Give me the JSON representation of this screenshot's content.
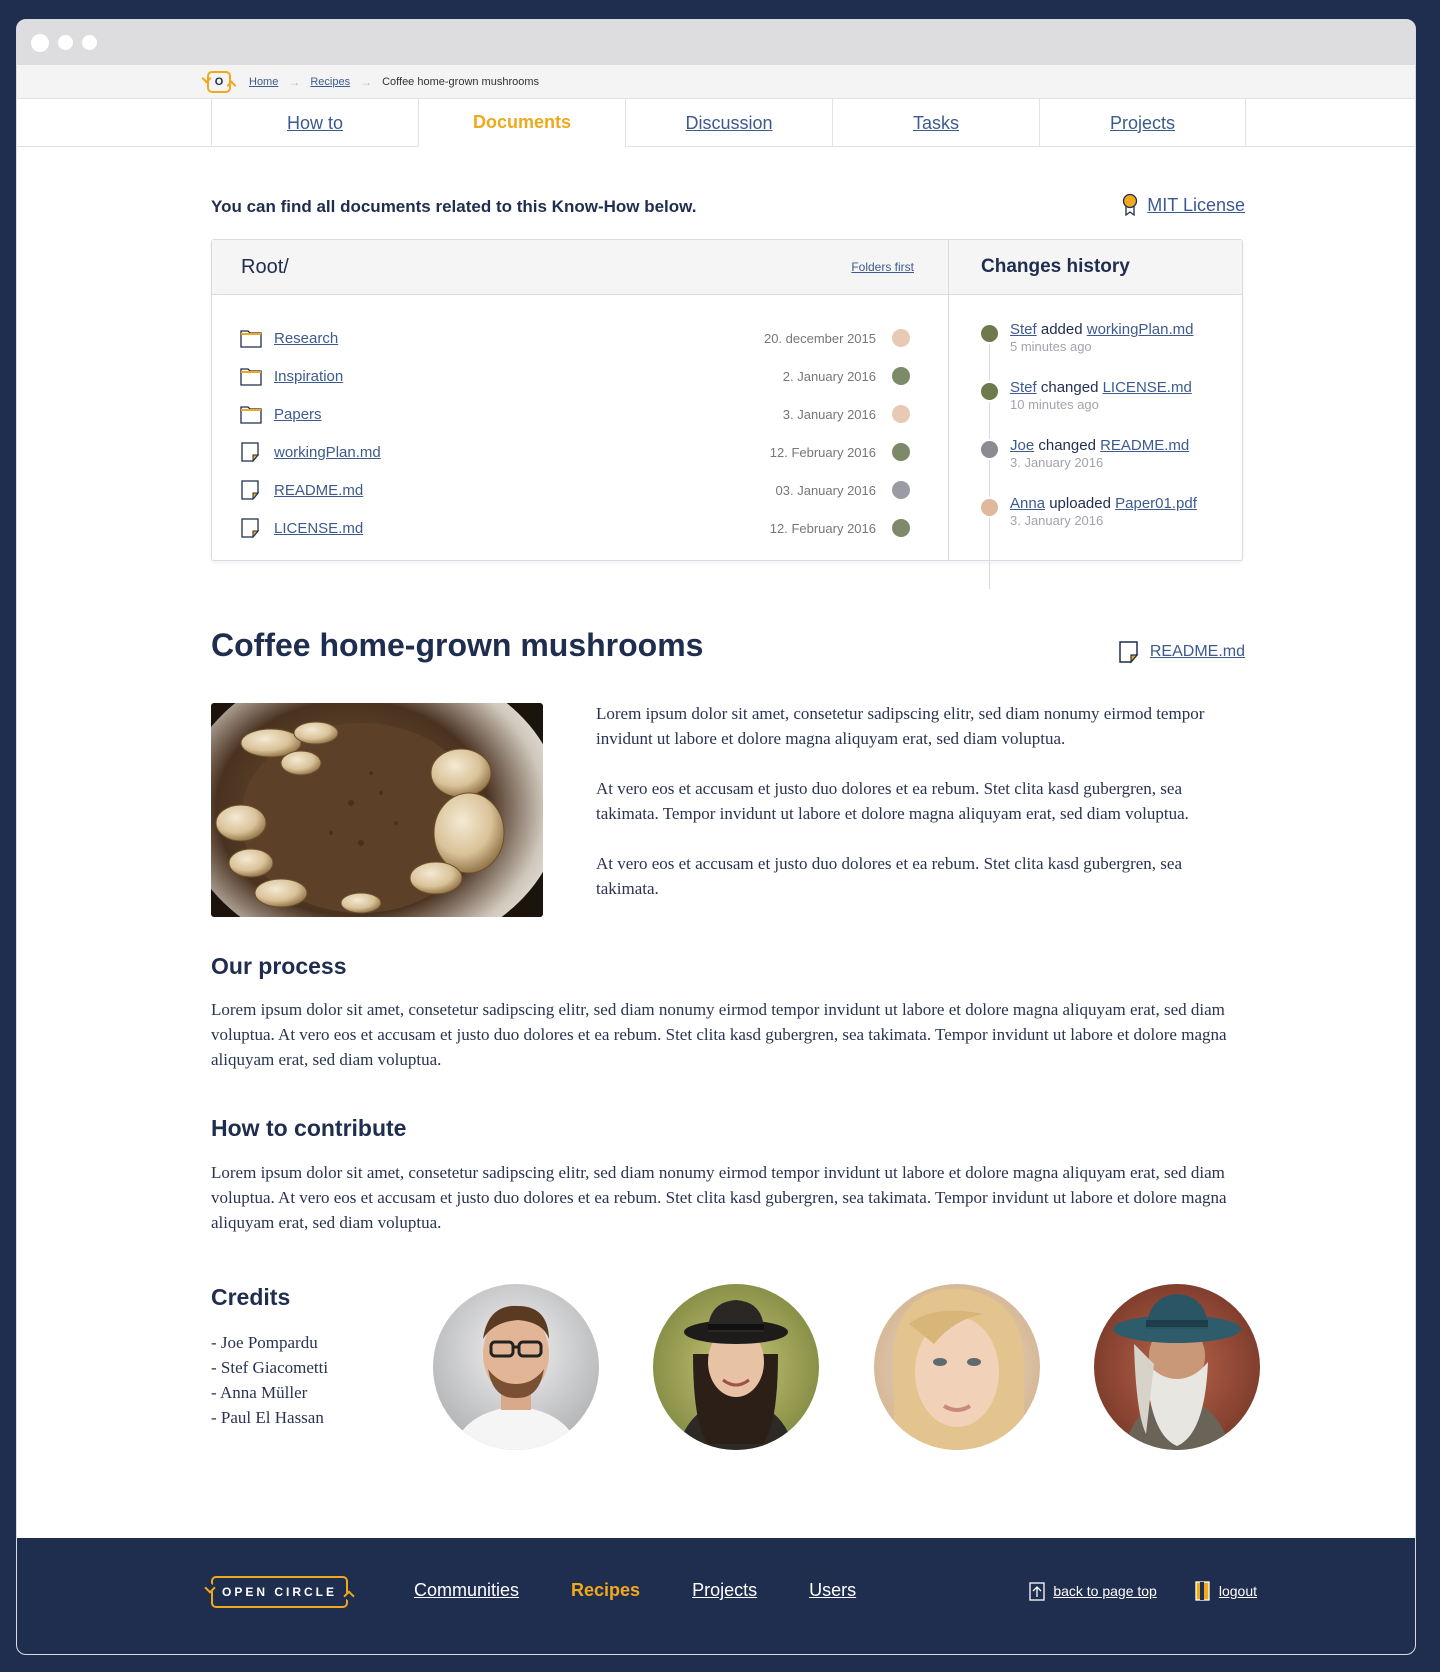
{
  "breadcrumb": {
    "logo": "O",
    "items": [
      "Home",
      "Recipes"
    ],
    "current": "Coffee home-grown mushrooms"
  },
  "tabs": [
    {
      "label": "How to",
      "active": false
    },
    {
      "label": "Documents",
      "active": true
    },
    {
      "label": "Discussion",
      "active": false
    },
    {
      "label": "Tasks",
      "active": false
    },
    {
      "label": "Projects",
      "active": false
    }
  ],
  "intro": {
    "text": "You can find all documents related to this Know-How below.",
    "license": "MIT License",
    "license_icon": "award-icon"
  },
  "files": {
    "root": "Root/",
    "sort_label": "Folders first",
    "rows": [
      {
        "name": "Research",
        "type": "folder",
        "date": "20. december 2015",
        "avatar_color": "#e8c9b4"
      },
      {
        "name": "Inspiration",
        "type": "folder",
        "date": "2. January 2016",
        "avatar_color": "#7d8a6a"
      },
      {
        "name": "Papers",
        "type": "folder",
        "date": "3. January 2016",
        "avatar_color": "#e8c9b4"
      },
      {
        "name": "workingPlan.md",
        "type": "file",
        "date": "12. February 2016",
        "avatar_color": "#7d8a6a"
      },
      {
        "name": "README.md",
        "type": "file",
        "date": "03. January 2016",
        "avatar_color": "#9a9ca3"
      },
      {
        "name": "LICENSE.md",
        "type": "file",
        "date": "12. February 2016",
        "avatar_color": "#7d8a6a"
      }
    ]
  },
  "history": {
    "title": "Changes history",
    "items": [
      {
        "user": "Stef",
        "action": "added",
        "target": "workingPlan.md",
        "time": "5 minutes ago",
        "avatar_color": "#6c7a4c"
      },
      {
        "user": "Stef",
        "action": "changed",
        "target": "LICENSE.md",
        "time": "10 minutes ago",
        "avatar_color": "#6c7a4c"
      },
      {
        "user": "Joe",
        "action": "changed",
        "target": "README.md",
        "time": "3. January 2016",
        "avatar_color": "#8a8c93"
      },
      {
        "user": "Anna",
        "action": "uploaded",
        "target": "Paper01.pdf",
        "time": "3. January 2016",
        "avatar_color": "#e0b89c"
      }
    ]
  },
  "doc": {
    "title": "Coffee home-grown mushrooms",
    "readme": "README.md",
    "intro_paragraphs": [
      "Lorem ipsum dolor sit amet, consetetur sadipscing elitr, sed diam nonumy eirmod tempor invidunt ut labore et dolore magna aliquyam erat, sed diam voluptua.",
      "At vero eos et accusam et justo duo dolores et ea rebum. Stet clita kasd gubergren, sea takimata. Tempor invidunt ut labore et dolore magna aliquyam erat, sed diam voluptua.",
      "At vero eos et accusam et justo duo dolores et ea rebum. Stet clita kasd gubergren, sea takimata."
    ],
    "process_title": "Our process",
    "process_body": "Lorem ipsum dolor sit amet, consetetur sadipscing elitr, sed diam nonumy eirmod tempor invidunt ut labore et dolore magna aliquyam erat, sed diam voluptua. At vero eos et accusam et justo duo dolores et ea rebum. Stet clita kasd gubergren, sea takimata. Tempor invidunt ut labore et dolore magna aliquyam erat, sed diam voluptua.",
    "contribute_title": "How to contribute",
    "contribute_body": "Lorem ipsum dolor sit amet, consetetur sadipscing elitr, sed diam nonumy eirmod tempor invidunt ut labore et dolore magna aliquyam erat, sed diam voluptua. At vero eos et accusam et justo duo dolores et ea rebum. Stet clita kasd gubergren, sea takimata. Tempor invidunt ut labore et dolore magna aliquyam erat, sed diam voluptua.",
    "credits_title": "Credits",
    "credits": [
      "- Joe Pompardu",
      "- Stef Giacometti",
      "- Anna Müller",
      "- Paul El Hassan"
    ]
  },
  "footer": {
    "logo": "OPEN CIRCLE",
    "nav": [
      {
        "label": "Communities",
        "active": false
      },
      {
        "label": "Recipes",
        "active": true
      },
      {
        "label": "Projects",
        "active": false
      },
      {
        "label": "Users",
        "active": false
      }
    ],
    "back_to_top": "back to page top",
    "logout": "logout"
  },
  "colors": {
    "navy": "#1f2d4e",
    "accent": "#f0a81c",
    "link": "#3d5a8f"
  }
}
